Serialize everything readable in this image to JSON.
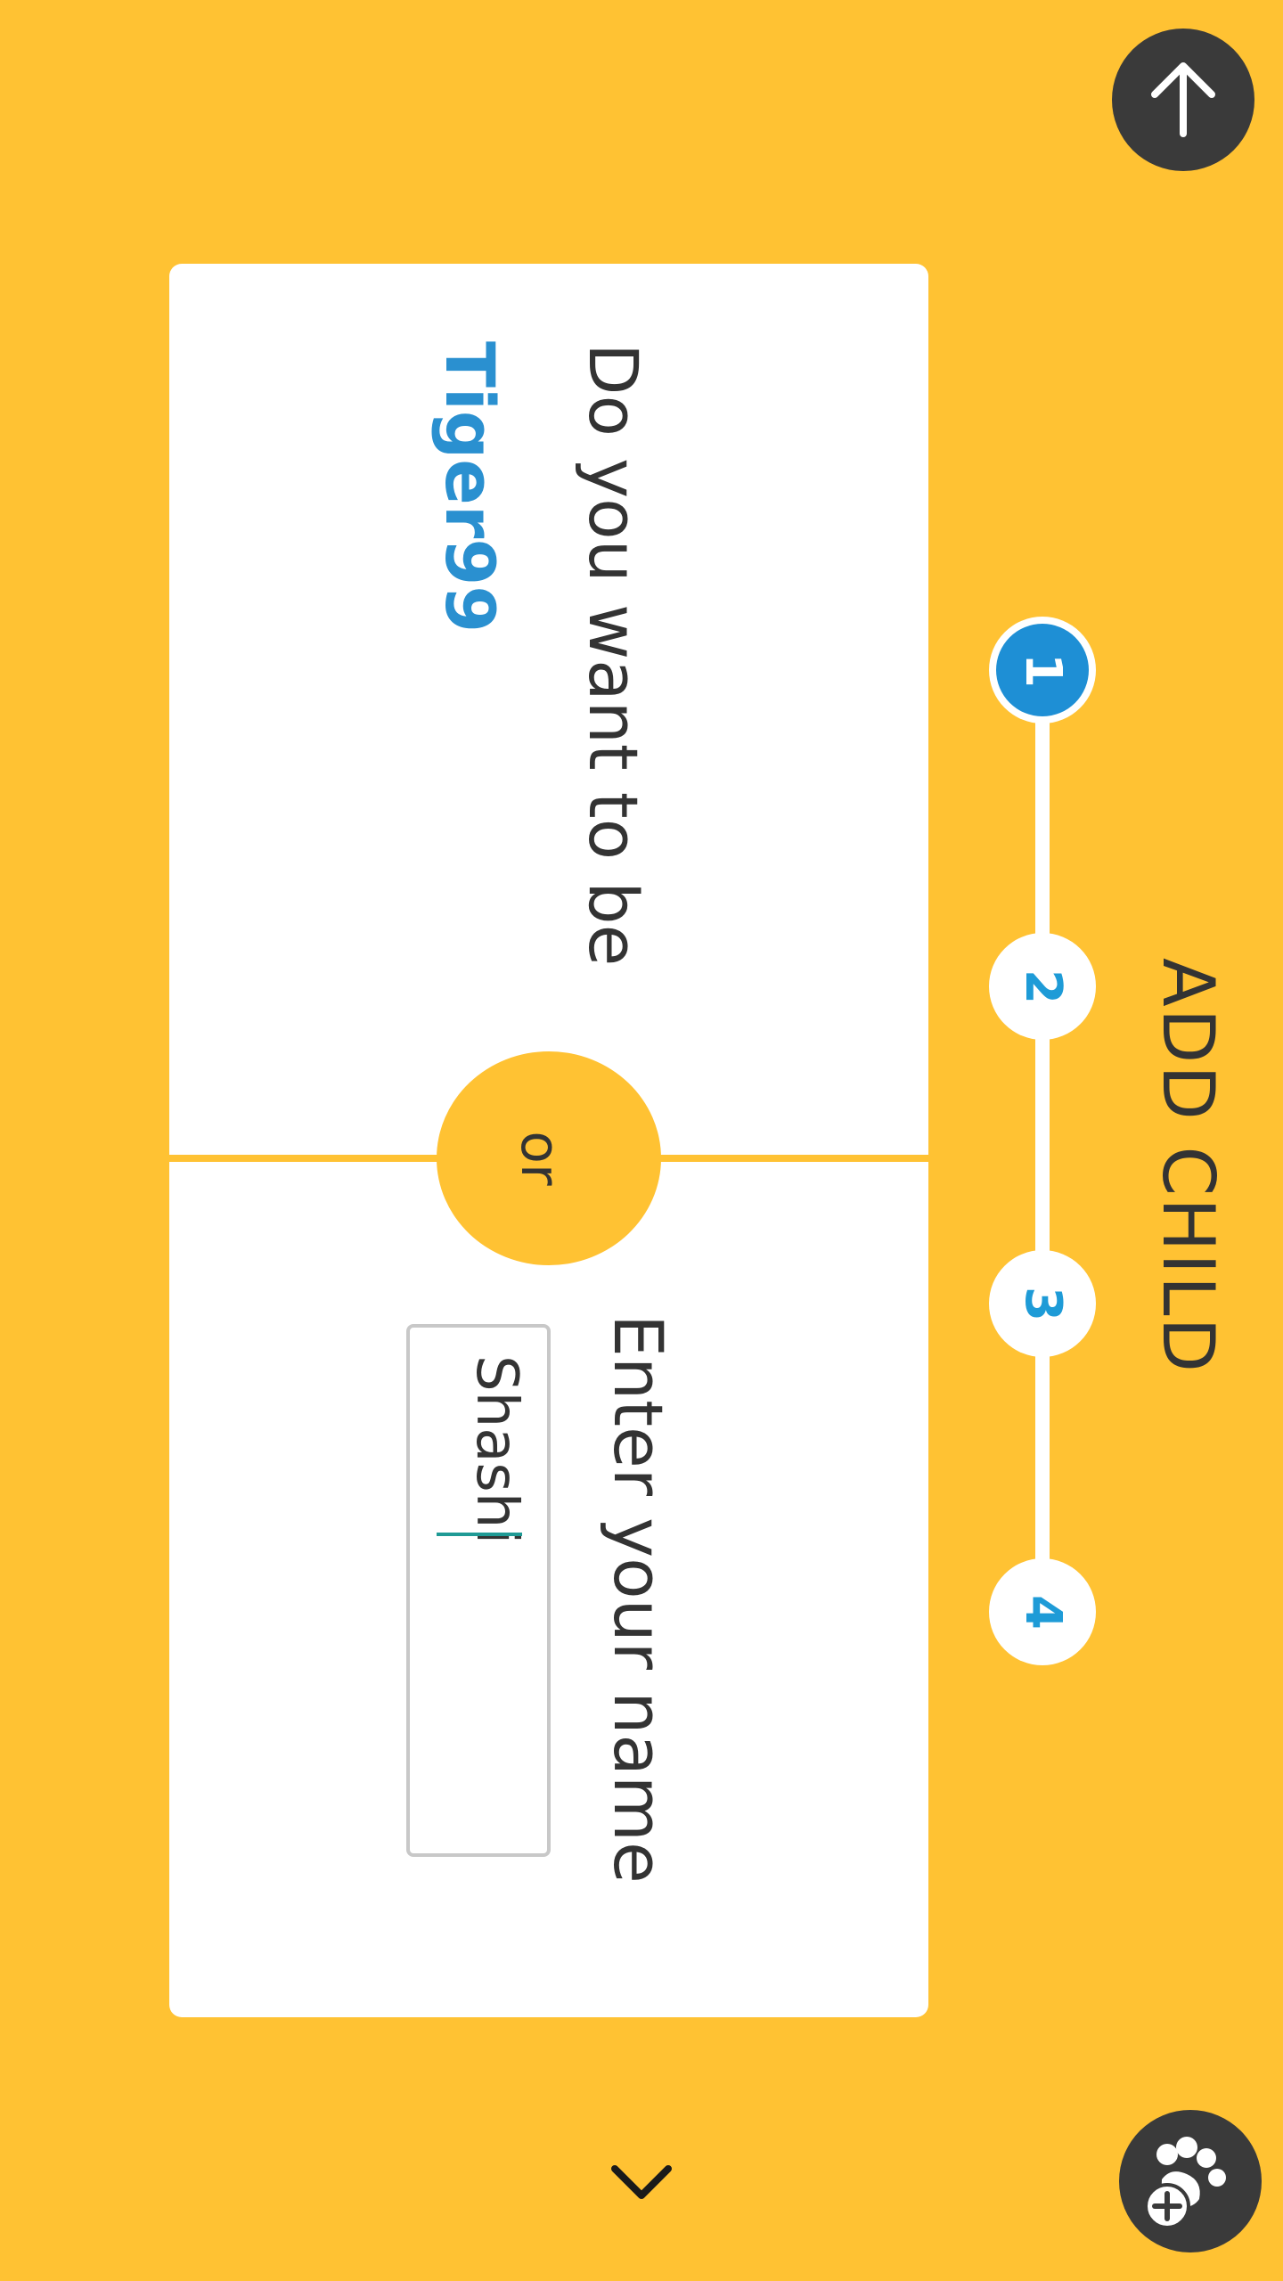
{
  "header": {
    "title": "ADD CHILD"
  },
  "stepper": {
    "steps": [
      "1",
      "2",
      "3",
      "4"
    ],
    "active_step": 1
  },
  "card": {
    "question_suggest": "Do you want to be",
    "suggested_name": "Tiger99",
    "or_label": "or",
    "question_enter": "Enter your name",
    "name_input_value": "Shashi"
  },
  "icons": {
    "top_fab": "arrow-up-icon",
    "bottom_fab": "add-paw-icon",
    "bottom_chevron": "chevron-down-icon"
  },
  "colors": {
    "background": "#FFC233",
    "accent_blue": "#1E8FD5",
    "dark_fab": "#3A3A3A",
    "text": "#333333",
    "caret": "#1F9A95"
  }
}
